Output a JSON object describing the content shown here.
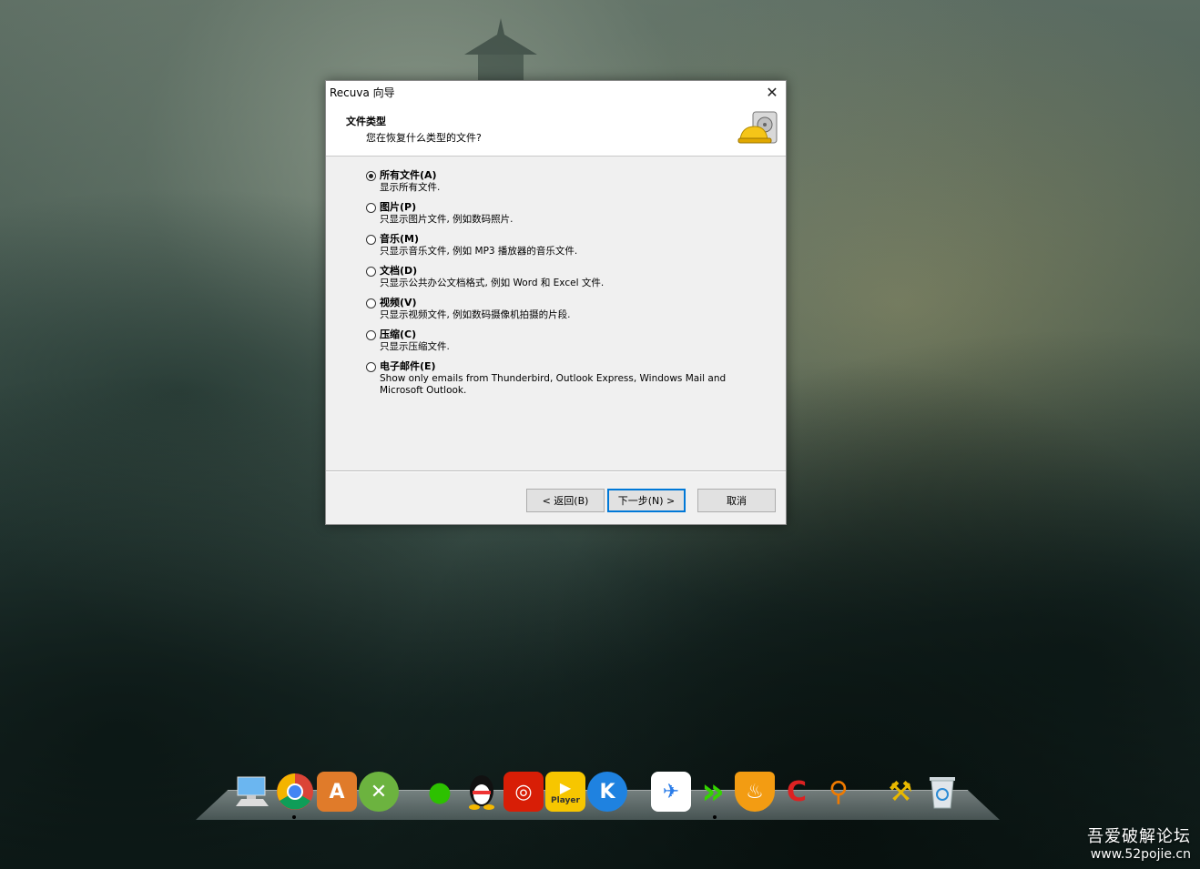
{
  "window": {
    "title": "Recuva 向导",
    "close_symbol": "✕"
  },
  "header": {
    "title": "文件类型",
    "subtitle": "您在恢复什么类型的文件?",
    "icon": "recuva-hardhat-disk-icon"
  },
  "options": [
    {
      "label": "所有文件(A)",
      "desc": "显示所有文件.",
      "checked": true
    },
    {
      "label": "图片(P)",
      "desc": "只显示图片文件, 例如数码照片.",
      "checked": false
    },
    {
      "label": "音乐(M)",
      "desc": "只显示音乐文件, 例如 MP3 播放器的音乐文件.",
      "checked": false
    },
    {
      "label": "文档(D)",
      "desc": "只显示公共办公文档格式, 例如 Word 和 Excel 文件.",
      "checked": false
    },
    {
      "label": "视频(V)",
      "desc": "只显示视频文件, 例如数码摄像机拍摄的片段.",
      "checked": false
    },
    {
      "label": "压缩(C)",
      "desc": "只显示压缩文件.",
      "checked": false
    },
    {
      "label": "电子邮件(E)",
      "desc": "Show only emails from Thunderbird, Outlook Express, Windows Mail and Microsoft Outlook.",
      "checked": false
    }
  ],
  "buttons": {
    "back": "< 返回(B)",
    "next": "下一步(N) >",
    "cancel": "取消"
  },
  "dock": {
    "items": [
      {
        "name": "finder-icon",
        "glyph": "🖥"
      },
      {
        "name": "chrome-icon",
        "glyph": "◉"
      },
      {
        "name": "app-store-icon",
        "glyph": "A"
      },
      {
        "name": "xbox-icon",
        "glyph": "✕"
      },
      {
        "name": "wechat-icon",
        "glyph": "💬"
      },
      {
        "name": "qq-icon",
        "glyph": "🐧"
      },
      {
        "name": "netease-music-icon",
        "glyph": "◎"
      },
      {
        "name": "player-icon",
        "glyph": "▶"
      },
      {
        "name": "kugou-icon",
        "glyph": "K"
      },
      {
        "name": "feishu-icon",
        "glyph": "✈"
      },
      {
        "name": "arrow-app-icon",
        "glyph": "»"
      },
      {
        "name": "shield-flame-icon",
        "glyph": "🔥"
      },
      {
        "name": "ccleaner-icon",
        "glyph": "C"
      },
      {
        "name": "search-tool-icon",
        "glyph": "🔍"
      },
      {
        "name": "tools-icon",
        "glyph": "⚒"
      },
      {
        "name": "recycle-bin-icon",
        "glyph": "🗑"
      }
    ],
    "player_text": "Player"
  },
  "watermark": {
    "line1": "吾爱破解论坛",
    "line2": "www.52pojie.cn"
  },
  "colors": {
    "dialog_bg": "#f0f0f0",
    "primary_border": "#0078d7"
  }
}
